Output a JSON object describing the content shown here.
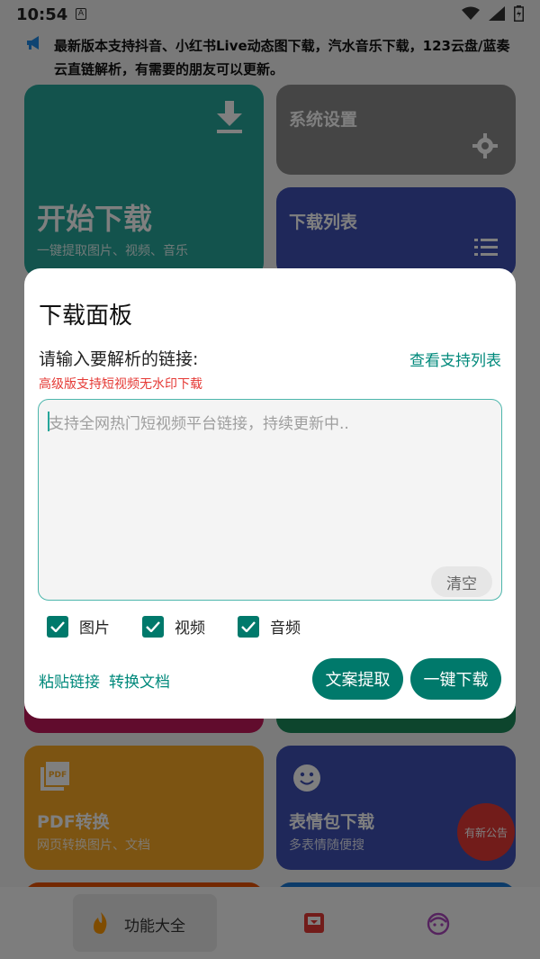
{
  "status_bar": {
    "time": "10:54",
    "notif_letter": "A"
  },
  "notice": {
    "text": "最新版本支持抖音、小红书Live动态图下载，汽水音乐下载，123云盘/蓝奏云直链解析，有需要的朋友可以更新。"
  },
  "cards": {
    "start": {
      "title": "开始下载",
      "subtitle": "一键提取图片、视频、音乐",
      "icon": "download-icon"
    },
    "settings": {
      "title": "系统设置",
      "icon": "gear-icon"
    },
    "download_list": {
      "title": "下载列表",
      "icon": "list-icon"
    },
    "pdf": {
      "title": "PDF转换",
      "subtitle": "网页转换图片、文档",
      "icon": "pdf-icon"
    },
    "emoji": {
      "title": "表情包下载",
      "subtitle": "多表情随便搜",
      "icon": "smiley-icon"
    }
  },
  "fab": {
    "label": "有新公告"
  },
  "bottom_nav": {
    "items": [
      {
        "label": "功能大全",
        "icon": "flame-icon",
        "active": true
      },
      {
        "label": "",
        "icon": "download-box-icon",
        "active": false
      },
      {
        "label": "",
        "icon": "face-icon",
        "active": false
      }
    ]
  },
  "dialog": {
    "title": "下载面板",
    "input_label": "请输入要解析的链接:",
    "support_link": "查看支持列表",
    "premium_note": "高级版支持短视频无水印下载",
    "input_placeholder": "支持全网热门短视频平台链接，持续更新中..",
    "clear_label": "清空",
    "checkboxes": [
      {
        "label": "图片",
        "checked": true
      },
      {
        "label": "视频",
        "checked": true
      },
      {
        "label": "音频",
        "checked": true
      }
    ],
    "paste_link": "粘贴链接",
    "convert_doc": "转换文档",
    "extract_text": "文案提取",
    "one_click_download": "一键下载"
  },
  "colors": {
    "accent": "#00796b",
    "warning": "#e53935"
  }
}
